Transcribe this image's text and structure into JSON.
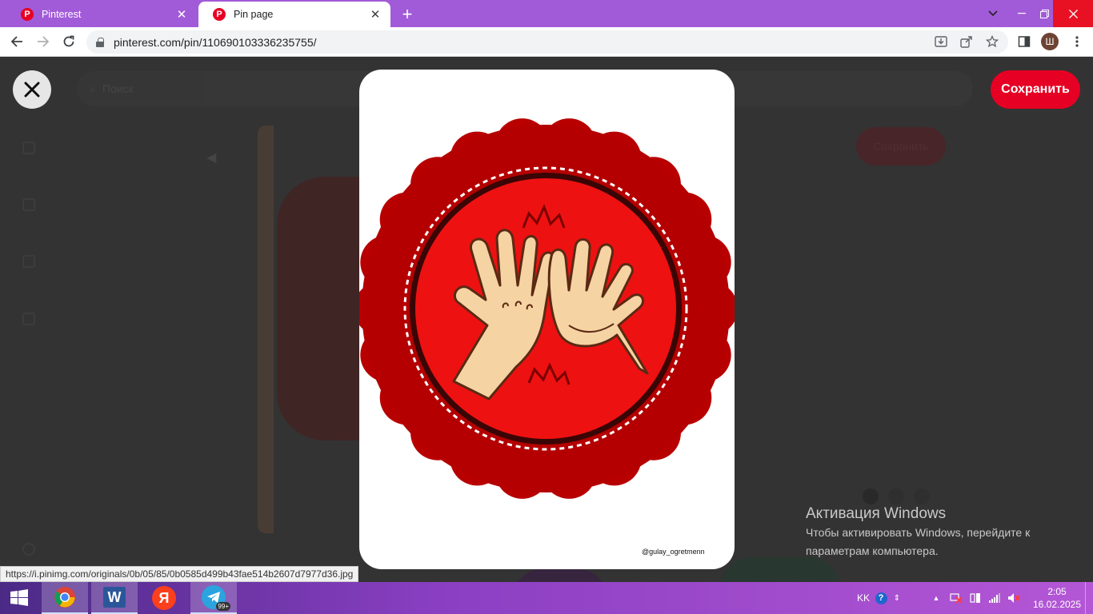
{
  "browser": {
    "tabs": [
      {
        "title": "Pinterest",
        "active": false
      },
      {
        "title": "Pin page",
        "active": true
      }
    ],
    "url": "pinterest.com/pin/110690103336235755/",
    "profile_initial": "Ш",
    "status_url": "https://i.pinimg.com/originals/0b/05/85/0b0585d499b43fae514b2607d7977d36.jpg"
  },
  "background_page": {
    "search_placeholder": "Поиск",
    "save_label": "Сохранить"
  },
  "pin_viewer": {
    "save_label": "Сохранить",
    "image_credit": "@gulay_ogretmenn",
    "badge_colors": {
      "outer": "#b80000",
      "inner": "#ee1111",
      "ring": "#3a0505"
    }
  },
  "windows_activation": {
    "title": "Активация Windows",
    "line1": "Чтобы активировать Windows, перейдите к",
    "line2": "параметрам компьютера."
  },
  "taskbar": {
    "apps": [
      "start-icon",
      "chrome-icon",
      "word-icon",
      "yandex-icon",
      "telegram-icon"
    ],
    "word_letter": "W",
    "yandex_letter": "Я",
    "telegram_badge": "99+",
    "language": "KK",
    "time": "2:05",
    "date": "16.02.2025"
  }
}
